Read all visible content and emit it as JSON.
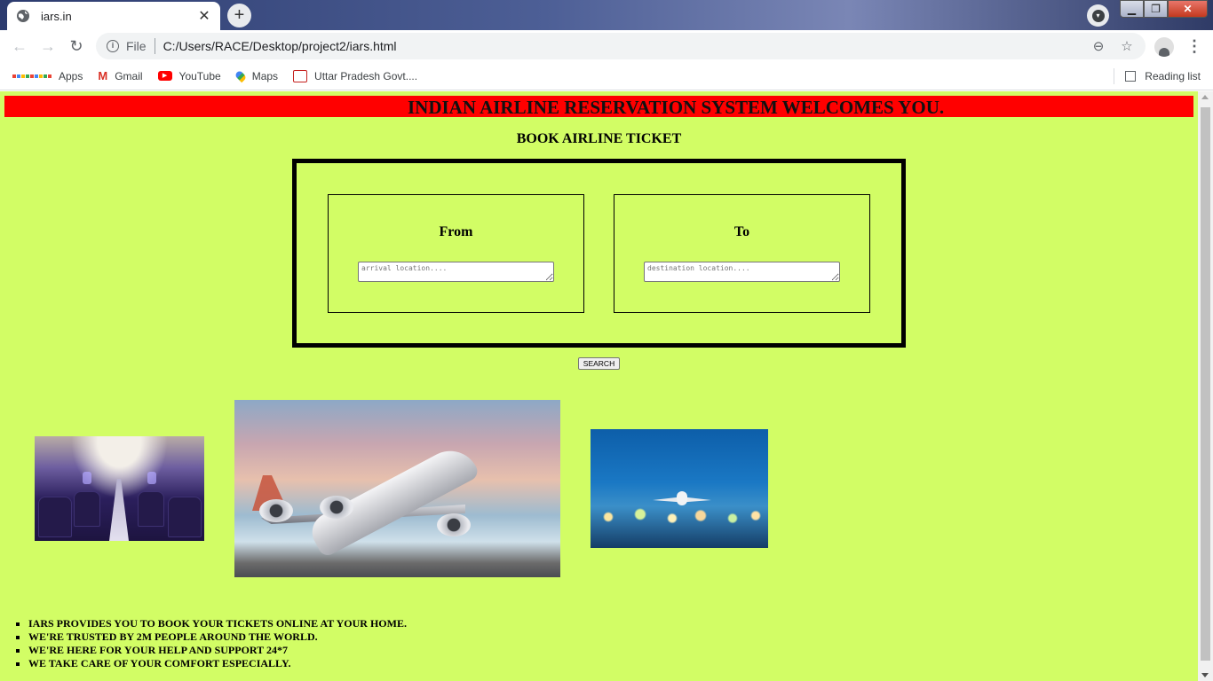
{
  "browser": {
    "tab_title": "iars.in",
    "tab_close": "✕",
    "new_tab": "+",
    "address_prefix": "File",
    "url": "C:/Users/RACE/Desktop/project2/iars.html",
    "bookmarks": [
      {
        "label": "Apps",
        "icon": "apps-grid-icon"
      },
      {
        "label": "Gmail",
        "icon": "gmail-icon"
      },
      {
        "label": "YouTube",
        "icon": "youtube-icon"
      },
      {
        "label": "Maps",
        "icon": "maps-icon"
      },
      {
        "label": "Uttar Pradesh Govt....",
        "icon": "govt-icon"
      }
    ],
    "reading_list": "Reading list"
  },
  "page": {
    "background_color": "#d2fd65",
    "banner": {
      "text": "INDIAN AIRLINE RESERVATION SYSTEM WELCOMES YOU.",
      "color": "#ff0000"
    },
    "heading": "BOOK AIRLINE TICKET",
    "from": {
      "label": "From",
      "placeholder": "arrival location....",
      "value": ""
    },
    "to": {
      "label": "To",
      "placeholder": "destination location....",
      "value": ""
    },
    "search_button": "SEARCH",
    "images": [
      {
        "name": "airplane-cabin-photo"
      },
      {
        "name": "airplane-takeoff-photo"
      },
      {
        "name": "airplane-runway-photo"
      }
    ],
    "features": [
      "IARS PROVIDES YOU TO BOOK YOUR TICKETS ONLINE AT YOUR HOME.",
      "WE'RE TRUSTED BY 2M PEOPLE AROUND THE WORLD.",
      "WE'RE HERE FOR YOUR HELP AND SUPPORT 24*7",
      "WE TAKE CARE OF YOUR COMFORT ESPECIALLY."
    ]
  }
}
